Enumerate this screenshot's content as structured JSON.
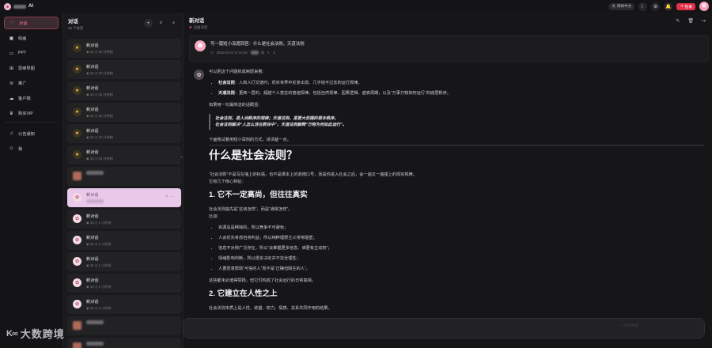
{
  "app": {
    "title_suffix": "AI"
  },
  "topbar": {
    "lang_label": "简体中文",
    "login_label": "登录"
  },
  "sidebar": {
    "items": [
      {
        "label": "对话",
        "icon": "heart-icon",
        "active": true
      },
      {
        "label": "绘画",
        "icon": "image-icon"
      },
      {
        "label": "PPT",
        "icon": "ppt-icon"
      },
      {
        "label": "思维导图",
        "icon": "mindmap-icon"
      },
      {
        "label": "推广",
        "icon": "wifi-icon"
      },
      {
        "label": "客户端",
        "icon": "cloud-icon"
      },
      {
        "label": "购买VIP",
        "icon": "crown-icon"
      }
    ],
    "bottom_items": [
      {
        "label": "公告通知",
        "icon": "bell-icon"
      },
      {
        "label": "我",
        "icon": "user-icon"
      }
    ]
  },
  "conversations": {
    "title": "对话",
    "subtitle": "30 个会话",
    "items": [
      {
        "name": "新对话",
        "count": "10",
        "time": "25 分钟前",
        "avatar": "star"
      },
      {
        "name": "新对话",
        "count": "10",
        "time": "33 分钟前",
        "avatar": "star"
      },
      {
        "name": "新对话",
        "count": "10",
        "time": "35 分钟前",
        "avatar": "star"
      },
      {
        "name": "新对话",
        "count": "10",
        "time": "36 分钟前",
        "avatar": "star"
      },
      {
        "name": "新对话",
        "count": "10",
        "time": "41 分钟前",
        "avatar": "star"
      },
      {
        "name": "新对话",
        "count": "10",
        "time": "43 分钟前",
        "avatar": "star"
      },
      {
        "name": "",
        "count": "",
        "time": "",
        "avatar": "blurred"
      },
      {
        "name": "新对话",
        "count": "",
        "time": "",
        "avatar": "flower",
        "active": true
      },
      {
        "name": "新对话",
        "count": "10",
        "time": "1 小时前",
        "avatar": "flower"
      },
      {
        "name": "新对话",
        "count": "10",
        "time": "1 小时前",
        "avatar": "flower"
      },
      {
        "name": "新对话",
        "count": "10",
        "time": "1 小时前",
        "avatar": "flower"
      },
      {
        "name": "新对话",
        "count": "10",
        "time": "1 小时前",
        "avatar": "flower"
      },
      {
        "name": "新对话",
        "count": "10",
        "time": "2 小时前",
        "avatar": "flower"
      },
      {
        "name": "",
        "count": "",
        "time": "",
        "avatar": "blurred"
      },
      {
        "name": "",
        "count": "10",
        "time": "2 小时前",
        "avatar": "blurred"
      }
    ]
  },
  "main": {
    "title": "新对话",
    "subtitle": "自由对话",
    "user_question": "写一篇短小深度回答：什么是社会法则，天道法则",
    "user_timestamp": "2026-04-20 17:42:59",
    "answer": {
      "intro": "可以把这个问题拆成两层来看：",
      "bullets": [
        {
          "term": "社会法则",
          "text": "：人和人打交道时，现实世界中反复出现、几乎绕不过去的运行规律。"
        },
        {
          "term": "天道法则",
          "text": "：更高一层的、超越个人意志的普遍规律，包括自然规律、因果逻辑、盛衰周期，以及“万事万物如何运行”的底层秩序。"
        }
      ],
      "summary_intro": "如果用一句最简洁的话概括：",
      "quote_line1": "社会法则，是人间秩序的规律；天道法则，是更大范围的根本秩序。",
      "quote_line2": "社会法则解决“人怎么活在群体中”，天道法则解释“万物为何如此运行”。",
      "transition": "下面我试着用短小深刻的方式，讲清楚一点。",
      "h1": "什么是社会法则？",
      "p1": "“社会法则”不是写在墙上的标语，也不是课本上的道德口号，而是你进入社会之后，会一遍又一遍撞上的现实规律。",
      "p2": "它有几个核心特征：",
      "h2_1": "1. 它不一定高尚，但往往真实",
      "p3": "社会法则首先是“这该怎样”，而是“通常怎样”。",
      "p4": "比如：",
      "list": [
        "资源总是稀缺的，所以竞争不可避免；",
        "人会优先考虑自身利益，所以纯粹理想主义常常碰壁；",
        "信息不对称广泛存在，所以“会掌握更多信息、谁更有主动权”；",
        "情绪影响判断，所以很多决定并不完全理性；",
        "人更愿意帮助“可信的人”而不是“正确但陌生的人”。"
      ],
      "p5": "这些都未必值得赞扬，但它们构成了社会运行的日常真相。",
      "h2_2": "2. 它建立在人性之上",
      "p6": "社会法则本质上是人性、欲望、权力、情感、关系共同作用的结果。"
    },
    "back_to_bottom": "回到底部"
  },
  "watermark": {
    "mark": "K∞",
    "text": "大数跨境"
  }
}
